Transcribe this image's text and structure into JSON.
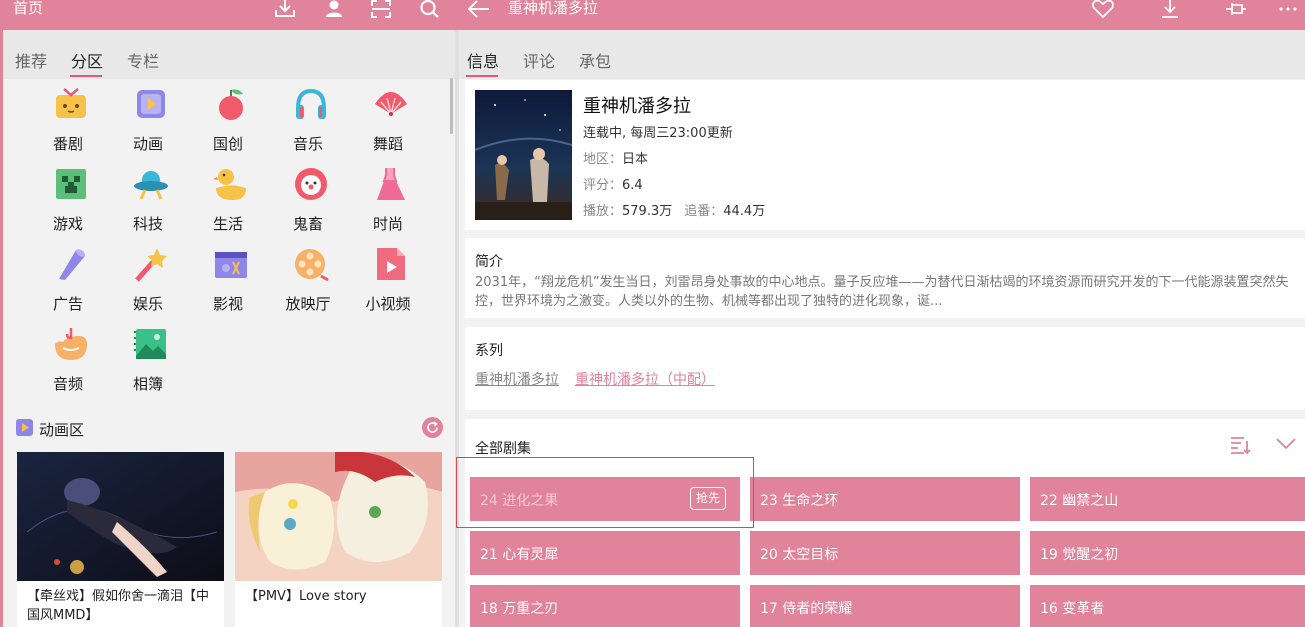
{
  "left_header": {
    "title": "首页"
  },
  "right_header": {
    "title": "重神机潘多拉"
  },
  "left_tabs": [
    "推荐",
    "分区",
    "专栏"
  ],
  "right_tabs": [
    "信息",
    "评论",
    "承包"
  ],
  "zones": [
    {
      "label": "番剧",
      "icon": "tv-icon"
    },
    {
      "label": "动画",
      "icon": "play-box-icon"
    },
    {
      "label": "国创",
      "icon": "cherry-icon"
    },
    {
      "label": "音乐",
      "icon": "headphones-icon"
    },
    {
      "label": "舞蹈",
      "icon": "fan-icon"
    },
    {
      "label": "游戏",
      "icon": "creeper-icon"
    },
    {
      "label": "科技",
      "icon": "ufo-icon"
    },
    {
      "label": "生活",
      "icon": "duck-icon"
    },
    {
      "label": "鬼畜",
      "icon": "clown-icon"
    },
    {
      "label": "时尚",
      "icon": "dress-icon"
    },
    {
      "label": "广告",
      "icon": "megaphone-icon"
    },
    {
      "label": "娱乐",
      "icon": "magic-wand-icon"
    },
    {
      "label": "影视",
      "icon": "clapperboard-icon"
    },
    {
      "label": "放映厅",
      "icon": "film-reel-icon"
    },
    {
      "label": "小视频",
      "icon": "video-file-icon"
    },
    {
      "label": "音频",
      "icon": "audio-icon"
    },
    {
      "label": "相簿",
      "icon": "album-icon"
    }
  ],
  "animation_section": {
    "title": "动画区",
    "videos": [
      {
        "title": "【牵丝戏】假如你舍一滴泪【中国风MMD】"
      },
      {
        "title": "【PMV】Love story"
      }
    ]
  },
  "anime": {
    "title": "重神机潘多拉",
    "status": "连载中, 每周三23:00更新",
    "region_key": "地区：",
    "region_value": "日本",
    "rating_key": "评分：",
    "rating_value": "6.4",
    "plays_key": "播放：",
    "plays_value": "579.3万",
    "follows_key": "追番：",
    "follows_value": "44.4万"
  },
  "intro": {
    "heading": "简介",
    "text": "2031年，“翔龙危机”发生当日，刘雷昂身处事故的中心地点。量子反应堆——为替代日渐枯竭的环境资源而研究开发的下一代能源装置突然失控，世界环境为之激变。人类以外的生物、机械等都出现了独特的进化现象，诞..."
  },
  "series": {
    "heading": "系列",
    "items": [
      "重神机潘多拉",
      "重神机潘多拉（中配）"
    ]
  },
  "episodes": {
    "heading": "全部剧集",
    "badge": "抢先",
    "items": [
      "24 进化之果",
      "23 生命之环",
      "22 幽禁之山",
      "21 心有灵犀",
      "20 太空目标",
      "19 觉醒之初",
      "18 万重之刃",
      "17 侍者的荣耀",
      "16 变革者"
    ]
  },
  "colors": {
    "accent": "#e0839b",
    "tab_underline": "#e0597f",
    "series_active": "#e0839b"
  }
}
